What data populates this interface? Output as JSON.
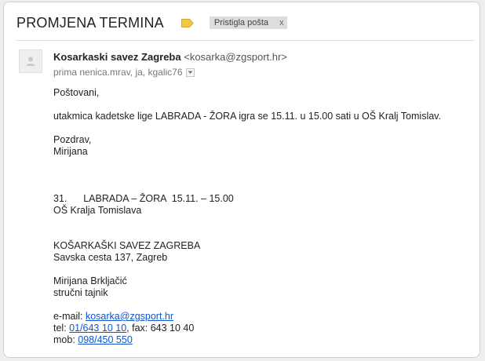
{
  "thread": {
    "subject": "PROMJENA TERMINA",
    "label_chip": "Pristigla pošta",
    "label_remove": "x"
  },
  "message": {
    "sender_name": "Kosarkaski savez Zagreba",
    "sender_email": "<kosarka@zgsport.hr>",
    "recipients": "prima nenica.mrav, ja, kgalic76"
  },
  "body": {
    "greeting": "Poštovani,",
    "line1": "utakmica kadetske lige LABRADA - ŽORA igra se 15.11. u 15.00 sati u OŠ Kralj Tomislav.",
    "closing": "Pozdrav,",
    "signoff_name": "Mirijana",
    "match_line": "31.      LABRADA – ŽORA  15.11. – 15.00",
    "venue": "OŠ Kralja Tomislava",
    "org_name": "KOŠARKAŠKI SAVEZ ZAGREBA",
    "org_address": "Savska cesta 137, Zagreb",
    "person_name": "Mirijana Brkljačić",
    "person_title": "stručni tajnik",
    "email_label": "e-mail: ",
    "email_link": "kosarka@zgsport.hr",
    "tel_label": "tel: ",
    "tel_link": "01/643 10 10",
    "fax_text": ", fax: 643 10 40",
    "mob_label": "mob: ",
    "mob_link": "098/450 550"
  },
  "colors": {
    "label_tag": "#f2c744",
    "link": "#1155cc",
    "chip_bg": "#dddddd"
  },
  "icons": {
    "label": "label-tag-icon",
    "avatar": "person-avatar-icon",
    "details": "chevron-down-icon"
  }
}
